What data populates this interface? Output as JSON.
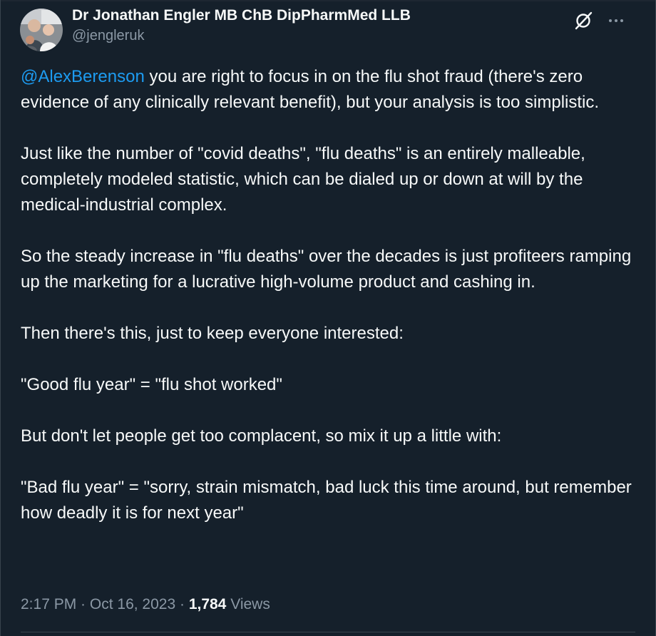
{
  "author": {
    "display_name": "Dr Jonathan Engler MB ChB DipPharmMed LLB",
    "handle": "@jengleruk",
    "avatar_icon": "profile-photo"
  },
  "header_icons": {
    "grok": "grok-icon",
    "more": "more-icon"
  },
  "tweet": {
    "mention": "@AlexBerenson",
    "paragraph_1_rest": " you are right to focus in on the flu shot fraud (there's zero evidence of any clinically relevant benefit), but your analysis is too simplistic.",
    "paragraph_2": "Just like the number of \"covid deaths\", \"flu deaths\" is an entirely malleable, completely modeled statistic, which can be dialed up or down at will by the medical-industrial complex.",
    "paragraph_3": "So the steady increase in \"flu deaths\" over the decades is just profiteers ramping up the marketing for a lucrative high-volume product and cashing in.",
    "paragraph_4": "Then there's this, just to keep everyone interested:",
    "paragraph_5": "\"Good flu year\" = \"flu shot worked\"",
    "paragraph_6": "But don't let people get too complacent, so mix it up a little with:",
    "paragraph_7": "\"Bad flu year\" = \"sorry, strain mismatch, bad luck this time around, but remember how deadly it is for next year\""
  },
  "meta": {
    "time": "2:17 PM",
    "separator": " · ",
    "date": "Oct 16, 2023",
    "views_count": "1,784",
    "views_label": " Views"
  },
  "colors": {
    "background": "#15202b",
    "text": "#f7f9f9",
    "secondary": "#8b98a5",
    "accent": "#1d9bf0",
    "border": "#38444d"
  }
}
